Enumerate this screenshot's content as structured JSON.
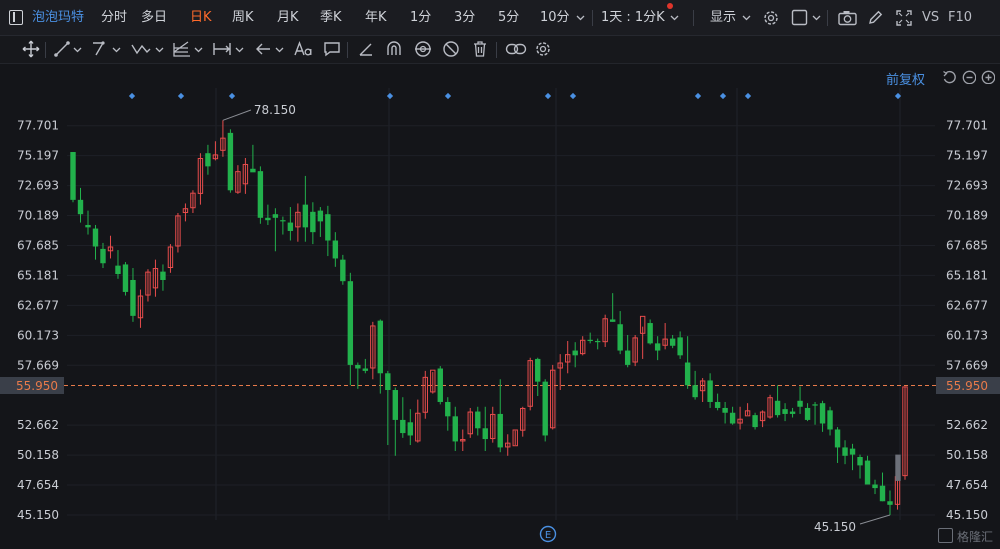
{
  "toolbar": {
    "symbol": "泡泡玛特",
    "periods": [
      "分时",
      "多日",
      "日K",
      "周K",
      "月K",
      "季K",
      "年K",
      "1分",
      "3分",
      "5分",
      "10分"
    ],
    "active_period": "日K",
    "multi": "1天 : 1分K",
    "display": "显示",
    "right_labels": [
      "VS",
      "F10"
    ]
  },
  "adjust_label": "前复权",
  "colors": {
    "up": "#e74c4c",
    "down": "#22b14c",
    "bg": "#141519",
    "accent": "#4a90e2",
    "current": "#e87a4a"
  },
  "icons": {
    "top": [
      "symbol-icon",
      "settings-gear-icon",
      "checkbox-icon",
      "chevron-down-icon",
      "camera-icon",
      "pen-icon",
      "fullscreen-icon"
    ],
    "draw": [
      "crosshair-move-icon",
      "line-tool-icon",
      "path-tool-icon",
      "wave-tool-icon",
      "fib-tool-icon",
      "measure-tool-icon",
      "arrow-tool-icon",
      "text-tool-icon",
      "comment-icon",
      "angle-icon",
      "magnet-icon",
      "eye-icon",
      "hide-icon",
      "trash-icon",
      "link-icon",
      "gear-icon"
    ],
    "controls": [
      "undo-icon",
      "zoom-out-icon",
      "zoom-in-icon"
    ]
  },
  "watermark": "格隆汇",
  "chart_data": {
    "type": "candlestick",
    "y_ticks": [
      "77.701",
      "75.197",
      "72.693",
      "70.189",
      "67.685",
      "65.181",
      "62.677",
      "60.173",
      "57.669",
      "55.950",
      "52.662",
      "50.158",
      "47.654",
      "45.150"
    ],
    "current_price": "55.950",
    "high_label": "78.150",
    "low_label": "45.150",
    "event_marker": "E",
    "ohlc": [
      [
        75.5,
        75.5,
        71.3,
        71.5
      ],
      [
        71.5,
        72.5,
        69.6,
        70.3
      ],
      [
        69.4,
        70.6,
        68.6,
        69.2
      ],
      [
        69.1,
        69.4,
        66.5,
        67.6
      ],
      [
        67.4,
        67.9,
        65.8,
        66.2
      ],
      [
        67.2,
        68.5,
        66.6,
        67.6
      ],
      [
        66.0,
        67.3,
        64.9,
        65.3
      ],
      [
        66.1,
        66.3,
        63.5,
        63.8
      ],
      [
        64.8,
        65.8,
        61.3,
        61.8
      ],
      [
        61.6,
        64.0,
        60.8,
        63.5
      ],
      [
        63.5,
        65.7,
        63.0,
        65.5
      ],
      [
        64.1,
        66.5,
        63.4,
        65.8
      ],
      [
        65.5,
        66.1,
        63.9,
        64.8
      ],
      [
        65.8,
        67.8,
        65.4,
        67.6
      ],
      [
        67.6,
        70.4,
        67.1,
        70.2
      ],
      [
        70.4,
        71.2,
        69.7,
        70.8
      ],
      [
        70.8,
        72.3,
        70.4,
        72.1
      ],
      [
        72.0,
        75.4,
        71.1,
        75.0
      ],
      [
        75.4,
        76.1,
        73.6,
        74.3
      ],
      [
        74.9,
        76.4,
        74.8,
        75.3
      ],
      [
        75.6,
        78.15,
        75.1,
        76.7
      ],
      [
        77.1,
        77.4,
        72.1,
        72.3
      ],
      [
        72.1,
        74.4,
        72.0,
        73.9
      ],
      [
        72.8,
        75.0,
        72.0,
        74.5
      ],
      [
        74.1,
        76.1,
        73.9,
        73.8
      ],
      [
        73.9,
        74.3,
        69.5,
        70.0
      ],
      [
        70.0,
        71.1,
        69.4,
        69.8
      ],
      [
        70.3,
        70.8,
        67.2,
        70.0
      ],
      [
        69.8,
        70.1,
        68.6,
        69.7
      ],
      [
        69.6,
        70.9,
        68.1,
        68.9
      ],
      [
        69.2,
        71.2,
        68.0,
        70.5
      ],
      [
        71.1,
        73.5,
        68.0,
        69.2
      ],
      [
        70.5,
        71.3,
        67.8,
        68.8
      ],
      [
        70.6,
        70.9,
        68.4,
        69.7
      ],
      [
        70.3,
        71.0,
        66.8,
        68.1
      ],
      [
        68.1,
        68.8,
        65.9,
        66.6
      ],
      [
        66.5,
        66.9,
        64.4,
        64.7
      ],
      [
        64.7,
        65.4,
        56.0,
        57.7
      ],
      [
        57.7,
        57.9,
        55.7,
        57.4
      ],
      [
        57.4,
        58.2,
        57.0,
        57.2
      ],
      [
        57.4,
        61.3,
        56.5,
        61.0
      ],
      [
        61.4,
        61.5,
        55.3,
        57.0
      ],
      [
        57.0,
        57.2,
        51.0,
        55.6
      ],
      [
        55.6,
        55.8,
        50.1,
        53.1
      ],
      [
        53.1,
        55.0,
        51.6,
        52.0
      ],
      [
        52.9,
        54.0,
        51.0,
        51.8
      ],
      [
        51.3,
        54.8,
        51.2,
        53.7
      ],
      [
        53.7,
        57.2,
        53.2,
        56.7
      ],
      [
        55.4,
        57.1,
        55.3,
        57.3
      ],
      [
        57.4,
        57.6,
        54.4,
        54.6
      ],
      [
        54.6,
        55.0,
        52.2,
        53.4
      ],
      [
        53.4,
        54.2,
        50.5,
        51.3
      ],
      [
        51.3,
        52.3,
        50.5,
        51.5
      ],
      [
        51.9,
        54.1,
        51.6,
        53.8
      ],
      [
        53.8,
        54.2,
        51.8,
        52.4
      ],
      [
        52.4,
        54.2,
        50.5,
        51.5
      ],
      [
        51.5,
        54.2,
        51.2,
        53.6
      ],
      [
        53.6,
        56.5,
        50.4,
        50.8
      ],
      [
        50.8,
        51.9,
        50.1,
        51.2
      ],
      [
        50.9,
        52.2,
        51.0,
        52.3
      ],
      [
        52.2,
        54.2,
        51.7,
        54.1
      ],
      [
        54.2,
        58.3,
        53.9,
        58.1
      ],
      [
        58.2,
        58.3,
        55.1,
        56.3
      ],
      [
        56.3,
        56.5,
        51.3,
        51.8
      ],
      [
        52.4,
        57.7,
        52.3,
        57.3
      ],
      [
        57.4,
        58.6,
        55.6,
        57.9
      ],
      [
        57.9,
        59.7,
        57.0,
        58.6
      ],
      [
        58.9,
        59.6,
        57.5,
        58.5
      ],
      [
        58.6,
        60.1,
        58.5,
        59.8
      ],
      [
        59.8,
        60.4,
        59.5,
        59.7
      ],
      [
        59.7,
        59.9,
        59.0,
        59.6
      ],
      [
        59.6,
        61.9,
        59.2,
        61.6
      ],
      [
        61.5,
        63.7,
        61.3,
        61.3
      ],
      [
        61.1,
        62.2,
        58.6,
        58.9
      ],
      [
        58.9,
        60.2,
        57.5,
        57.7
      ],
      [
        57.9,
        60.2,
        57.6,
        60.0
      ],
      [
        60.3,
        60.9,
        58.2,
        61.8
      ],
      [
        61.2,
        61.5,
        59.4,
        59.5
      ],
      [
        59.5,
        60.1,
        58.1,
        58.9
      ],
      [
        59.3,
        61.2,
        59.0,
        59.9
      ],
      [
        59.9,
        60.2,
        59.1,
        59.3
      ],
      [
        60.0,
        60.5,
        58.2,
        58.5
      ],
      [
        57.9,
        60.1,
        55.7,
        56.0
      ],
      [
        56.0,
        57.2,
        54.8,
        55.0
      ],
      [
        55.5,
        56.6,
        54.6,
        56.4
      ],
      [
        56.4,
        57.0,
        54.1,
        54.6
      ],
      [
        54.6,
        55.3,
        53.9,
        54.1
      ],
      [
        54.1,
        54.6,
        52.8,
        53.7
      ],
      [
        53.7,
        54.2,
        52.7,
        52.8
      ],
      [
        52.8,
        54.2,
        52.3,
        53.2
      ],
      [
        53.4,
        54.5,
        53.5,
        53.9
      ],
      [
        53.5,
        53.7,
        52.3,
        52.5
      ],
      [
        53.0,
        53.9,
        52.5,
        53.8
      ],
      [
        53.3,
        55.2,
        53.2,
        55.0
      ],
      [
        54.7,
        56.0,
        53.3,
        53.5
      ],
      [
        54.0,
        54.5,
        53.0,
        53.6
      ],
      [
        53.8,
        54.1,
        53.3,
        53.6
      ],
      [
        54.7,
        55.9,
        53.6,
        54.2
      ],
      [
        54.1,
        54.5,
        53.0,
        53.1
      ],
      [
        54.4,
        54.6,
        52.7,
        54.3
      ],
      [
        54.5,
        54.7,
        52.1,
        52.8
      ],
      [
        53.9,
        54.2,
        51.8,
        52.3
      ],
      [
        52.3,
        52.5,
        49.5,
        50.8
      ],
      [
        50.8,
        51.4,
        49.4,
        50.1
      ],
      [
        50.7,
        51.1,
        48.9,
        50.2
      ],
      [
        50.0,
        50.2,
        48.2,
        49.3
      ],
      [
        49.7,
        50.1,
        47.8,
        47.7
      ],
      [
        47.7,
        48.1,
        46.9,
        47.4
      ],
      [
        47.6,
        48.7,
        46.3,
        46.3
      ],
      [
        46.3,
        47.2,
        45.15,
        46.0
      ],
      [
        46.0,
        48.6,
        45.6,
        48.4
      ],
      [
        48.4,
        55.9,
        48.1,
        55.9
      ]
    ],
    "markers_count": 12
  }
}
